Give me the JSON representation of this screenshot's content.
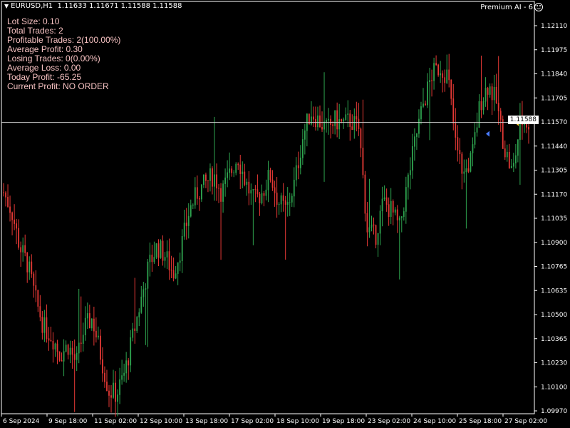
{
  "header": {
    "symbol": "EURUSD,H1",
    "ohlc": "1.11633 1.11671 1.11588 1.11588",
    "ea_name": "Premium AI - 6"
  },
  "stats": [
    "Lot Size: 0.10",
    "Total Trades: 2",
    "Profitable Trades: 2(100.00%)",
    "Average Profit: 0.30",
    "Losing  Trades: 0(0.00%)",
    "Average Loss: 0.00",
    "Today Profit: -65.25",
    "Current Profit: NO ORDER"
  ],
  "current_price_label": "1.11588",
  "colors": {
    "bull": "#2ea44f",
    "bear": "#e53935",
    "axis": "#ffffff",
    "background": "#000000",
    "price_line": "#ffffff",
    "text": "#f6c1c1"
  },
  "chart_data": {
    "type": "candlestick",
    "symbol": "EURUSD",
    "timeframe": "H1",
    "ylim": [
      1.0997,
      1.1226
    ],
    "y_ticks": [
      "1.12110",
      "1.11975",
      "1.11840",
      "1.11705",
      "1.11570",
      "1.11440",
      "1.11305",
      "1.11170",
      "1.11035",
      "1.10900",
      "1.10765",
      "1.10635",
      "1.10500",
      "1.10365",
      "1.10230",
      "1.10100",
      "1.09970"
    ],
    "x_ticks": [
      "6 Sep 2024",
      "9 Sep 18:00",
      "11 Sep 02:00",
      "12 Sep 10:00",
      "13 Sep 18:00",
      "17 Sep 02:00",
      "18 Sep 10:00",
      "19 Sep 18:00",
      "23 Sep 02:00",
      "24 Sep 10:00",
      "25 Sep 18:00",
      "27 Sep 02:00"
    ],
    "current_price": 1.11588,
    "price_path": [
      1.112,
      1.111,
      1.109,
      1.108,
      1.106,
      1.1045,
      1.104,
      1.103,
      1.1035,
      1.1025,
      1.1045,
      1.105,
      1.103,
      1.101,
      1.1008,
      1.102,
      1.104,
      1.106,
      1.108,
      1.109,
      1.1085,
      1.1075,
      1.109,
      1.111,
      1.112,
      1.1125,
      1.113,
      1.112,
      1.113,
      1.114,
      1.1125,
      1.1115,
      1.112,
      1.113,
      1.1115,
      1.111,
      1.1125,
      1.115,
      1.1165,
      1.116,
      1.1155,
      1.116,
      1.1158,
      1.116,
      1.1155,
      1.11,
      1.1095,
      1.1115,
      1.111,
      1.11,
      1.1125,
      1.115,
      1.117,
      1.1185,
      1.119,
      1.1185,
      1.1145,
      1.113,
      1.114,
      1.117,
      1.118,
      1.117,
      1.1145,
      1.113,
      1.116,
      1.1158
    ]
  }
}
